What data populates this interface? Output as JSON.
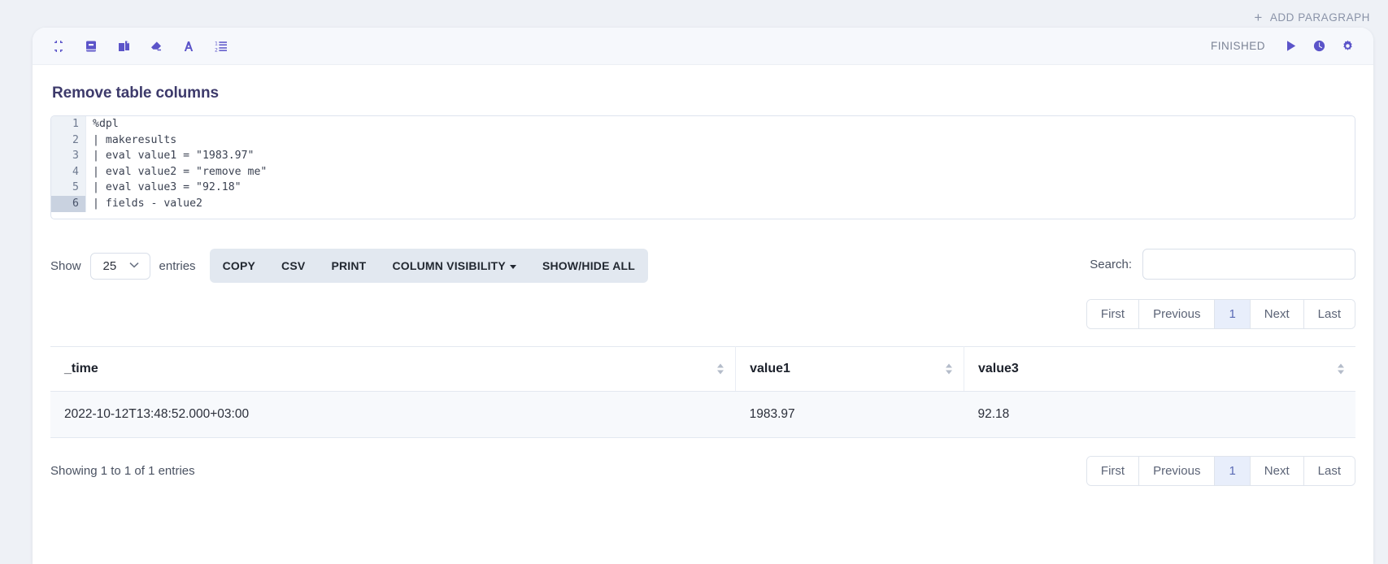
{
  "topbar": {
    "add_paragraph_label": "ADD PARAGRAPH",
    "plus_glyph": "+"
  },
  "paragraph": {
    "title": "Remove table columns",
    "status": "FINISHED",
    "toolbar_icons": [
      "compress-icon",
      "book-icon",
      "copy-pages-icon",
      "eraser-icon",
      "font-icon",
      "numbered-list-icon"
    ],
    "action_icons": [
      "run-icon",
      "clock-icon",
      "gear-icon"
    ]
  },
  "editor": {
    "lines": [
      {
        "n": "1",
        "text": "%dpl",
        "active": false
      },
      {
        "n": "2",
        "text": "| makeresults",
        "active": false
      },
      {
        "n": "3",
        "text": "| eval value1 = \"1983.97\"",
        "active": false
      },
      {
        "n": "4",
        "text": "| eval value2 = \"remove me\"",
        "active": false
      },
      {
        "n": "5",
        "text": "| eval value3 = \"92.18\"",
        "active": false
      },
      {
        "n": "6",
        "text": "| fields - value2",
        "active": true
      }
    ]
  },
  "controls": {
    "show_label": "Show",
    "entries_label": "entries",
    "page_size": "25",
    "chevron": "⌄",
    "buttons": [
      {
        "label": "COPY",
        "caret": false
      },
      {
        "label": "CSV",
        "caret": false
      },
      {
        "label": "PRINT",
        "caret": false
      },
      {
        "label": "COLUMN VISIBILITY",
        "caret": true
      },
      {
        "label": "SHOW/HIDE ALL",
        "caret": false
      }
    ],
    "search_label": "Search:",
    "search_value": "",
    "search_placeholder": ""
  },
  "pagination": {
    "first": "First",
    "previous": "Previous",
    "page": "1",
    "next": "Next",
    "last": "Last"
  },
  "table": {
    "columns": [
      "_time",
      "value1",
      "value3"
    ],
    "rows": [
      [
        "2022-10-12T13:48:52.000+03:00",
        "1983.97",
        "92.18"
      ]
    ]
  },
  "footer": {
    "showing_text": "Showing 1 to 1 of 1 entries"
  },
  "colors": {
    "accent": "#5b54c9",
    "page_bg": "#eef1f6",
    "active_page": "#e8eefb"
  }
}
